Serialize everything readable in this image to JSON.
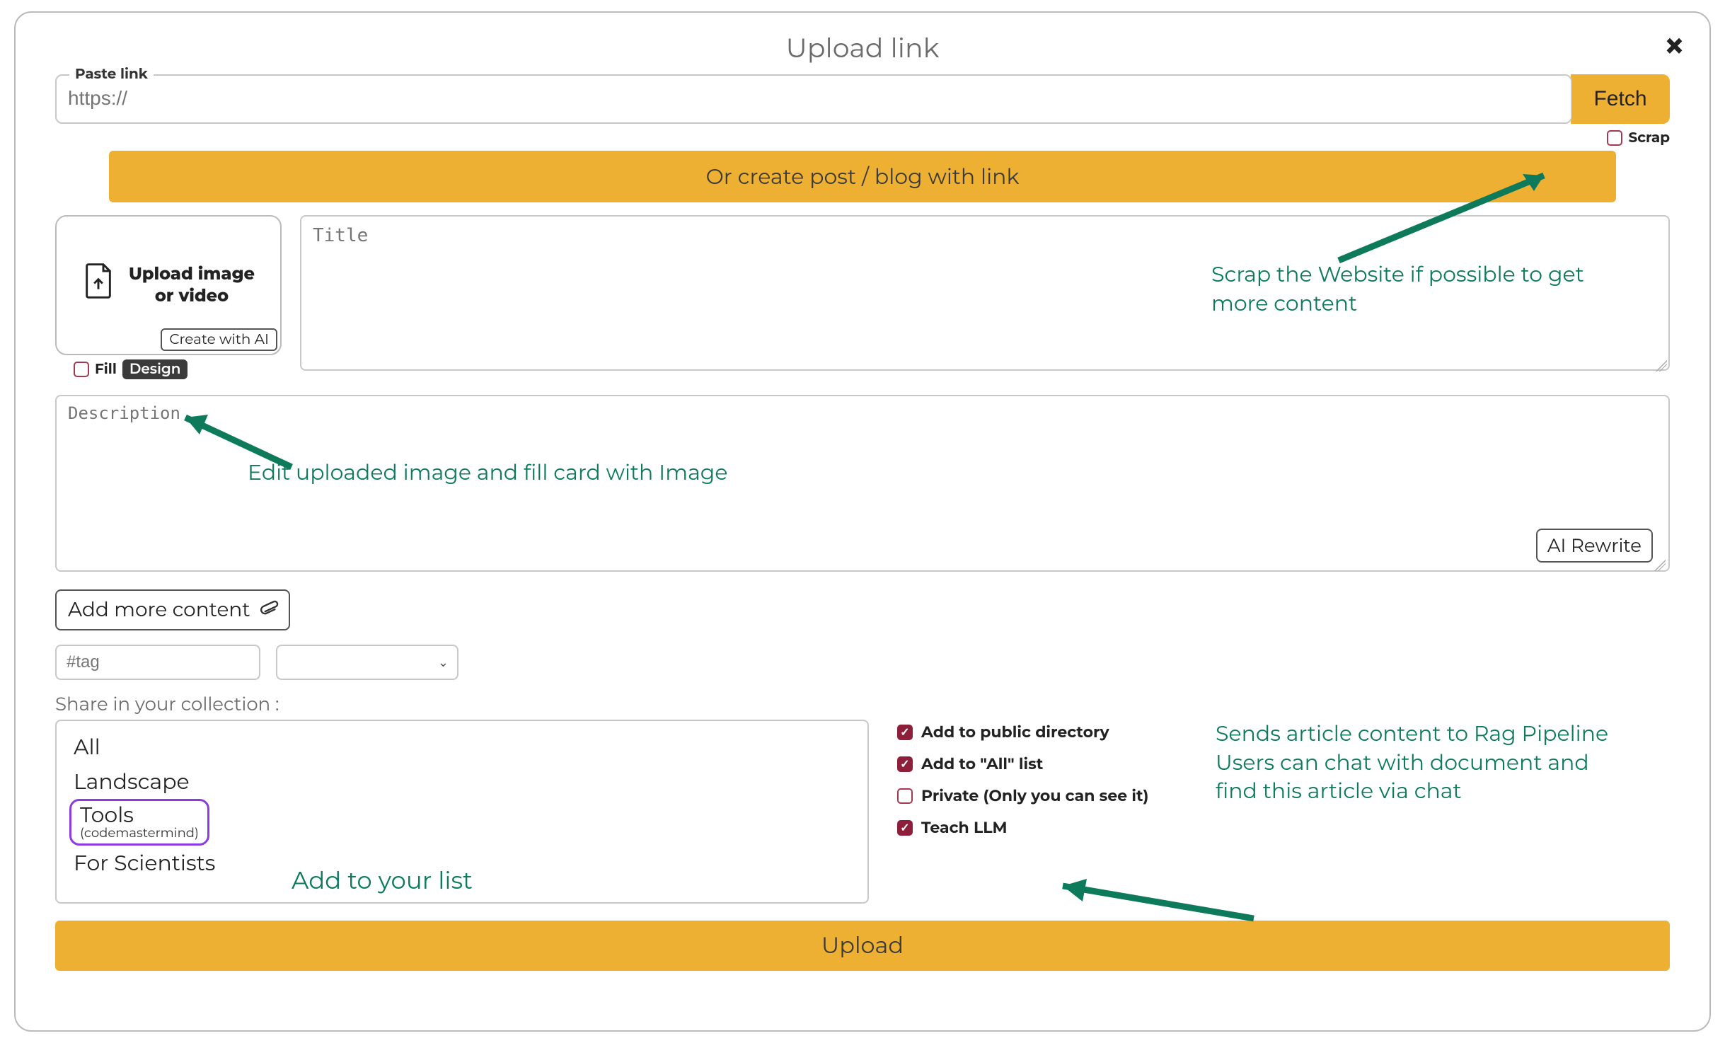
{
  "modal": {
    "title": "Upload link",
    "close_icon": "×"
  },
  "link": {
    "legend": "Paste link",
    "placeholder": "https://",
    "fetch_label": "Fetch",
    "scrap_label": "Scrap"
  },
  "or_bar": "Or create post / blog with link",
  "upload_card": {
    "text": "Upload image or video",
    "create_ai": "Create with AI"
  },
  "below_card": {
    "fill_label": "Fill",
    "design_label": "Design"
  },
  "title_placeholder": "Title",
  "description_placeholder": "Description",
  "ai_rewrite": "AI Rewrite",
  "add_more": "Add more content",
  "tag_placeholder": "#tag",
  "share_label": "Share in your collection :",
  "collections": [
    {
      "name": "All"
    },
    {
      "name": "Landscape"
    },
    {
      "name": "Tools",
      "sub": "(codemastermind)",
      "highlight": true
    },
    {
      "name": "For Scientists"
    }
  ],
  "checks": {
    "public": {
      "label": "Add to public directory",
      "checked": true
    },
    "all": {
      "label": "Add to \"All\" list",
      "checked": true
    },
    "private": {
      "label": "Private (Only you can see it)",
      "checked": false
    },
    "teach": {
      "label": "Teach LLM",
      "checked": true
    }
  },
  "upload_button": "Upload",
  "annotations": {
    "scrap": "Scrap the Website if possible to get more content",
    "fill": "Edit uploaded image and fill card with Image",
    "list": "Add to your list",
    "teach1": "Sends article content to Rag Pipeline",
    "teach2": "Users can chat with document and",
    "teach3": "find this article via chat"
  }
}
